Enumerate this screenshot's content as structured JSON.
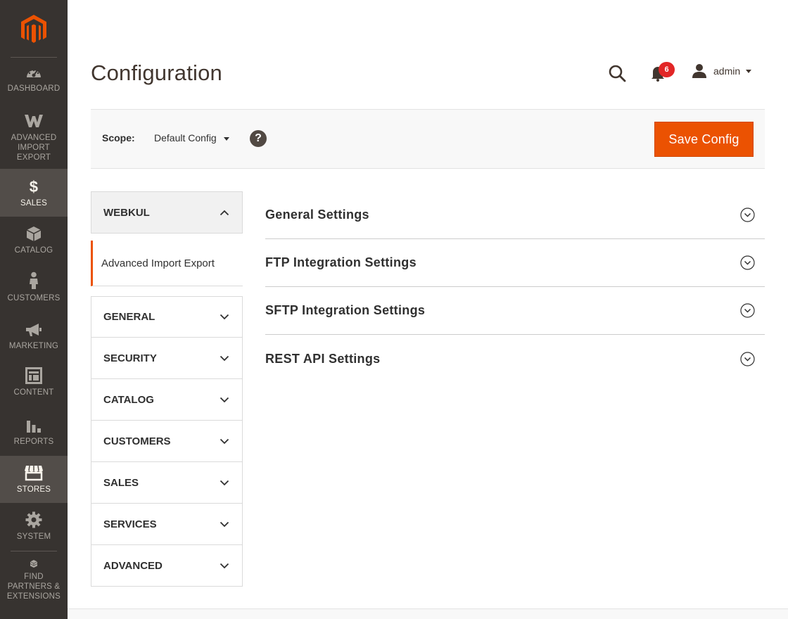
{
  "colors": {
    "nav_bg": "#373330",
    "nav_active_bg": "#524d49",
    "accent": "#eb5202",
    "badge": "#e22626"
  },
  "nav": {
    "logo": "magento-logo-icon",
    "items": [
      {
        "label": "DASHBOARD",
        "icon": "dashboard-icon"
      },
      {
        "label": "ADVANCED IMPORT EXPORT",
        "icon": "webkul-w-icon"
      },
      {
        "label": "SALES",
        "icon": "dollar-icon"
      },
      {
        "label": "CATALOG",
        "icon": "box-icon"
      },
      {
        "label": "CUSTOMERS",
        "icon": "person-icon"
      },
      {
        "label": "MARKETING",
        "icon": "megaphone-icon"
      },
      {
        "label": "CONTENT",
        "icon": "layout-icon"
      },
      {
        "label": "REPORTS",
        "icon": "bar-chart-icon"
      },
      {
        "label": "STORES",
        "icon": "store-icon"
      },
      {
        "label": "SYSTEM",
        "icon": "gear-icon"
      },
      {
        "label": "FIND PARTNERS & EXTENSIONS",
        "icon": "extensions-cube-icon"
      }
    ]
  },
  "header": {
    "title": "Configuration",
    "notifications_count": "6",
    "user": "admin"
  },
  "scope": {
    "label": "Scope:",
    "value": "Default Config",
    "save_label": "Save Config"
  },
  "tabs": {
    "group": "WEBKUL",
    "active": "Advanced Import Export",
    "sections": [
      "GENERAL",
      "SECURITY",
      "CATALOG",
      "CUSTOMERS",
      "SALES",
      "SERVICES",
      "ADVANCED"
    ]
  },
  "main": {
    "sections": [
      "General Settings",
      "FTP Integration Settings",
      "SFTP Integration Settings",
      "REST API Settings"
    ]
  }
}
